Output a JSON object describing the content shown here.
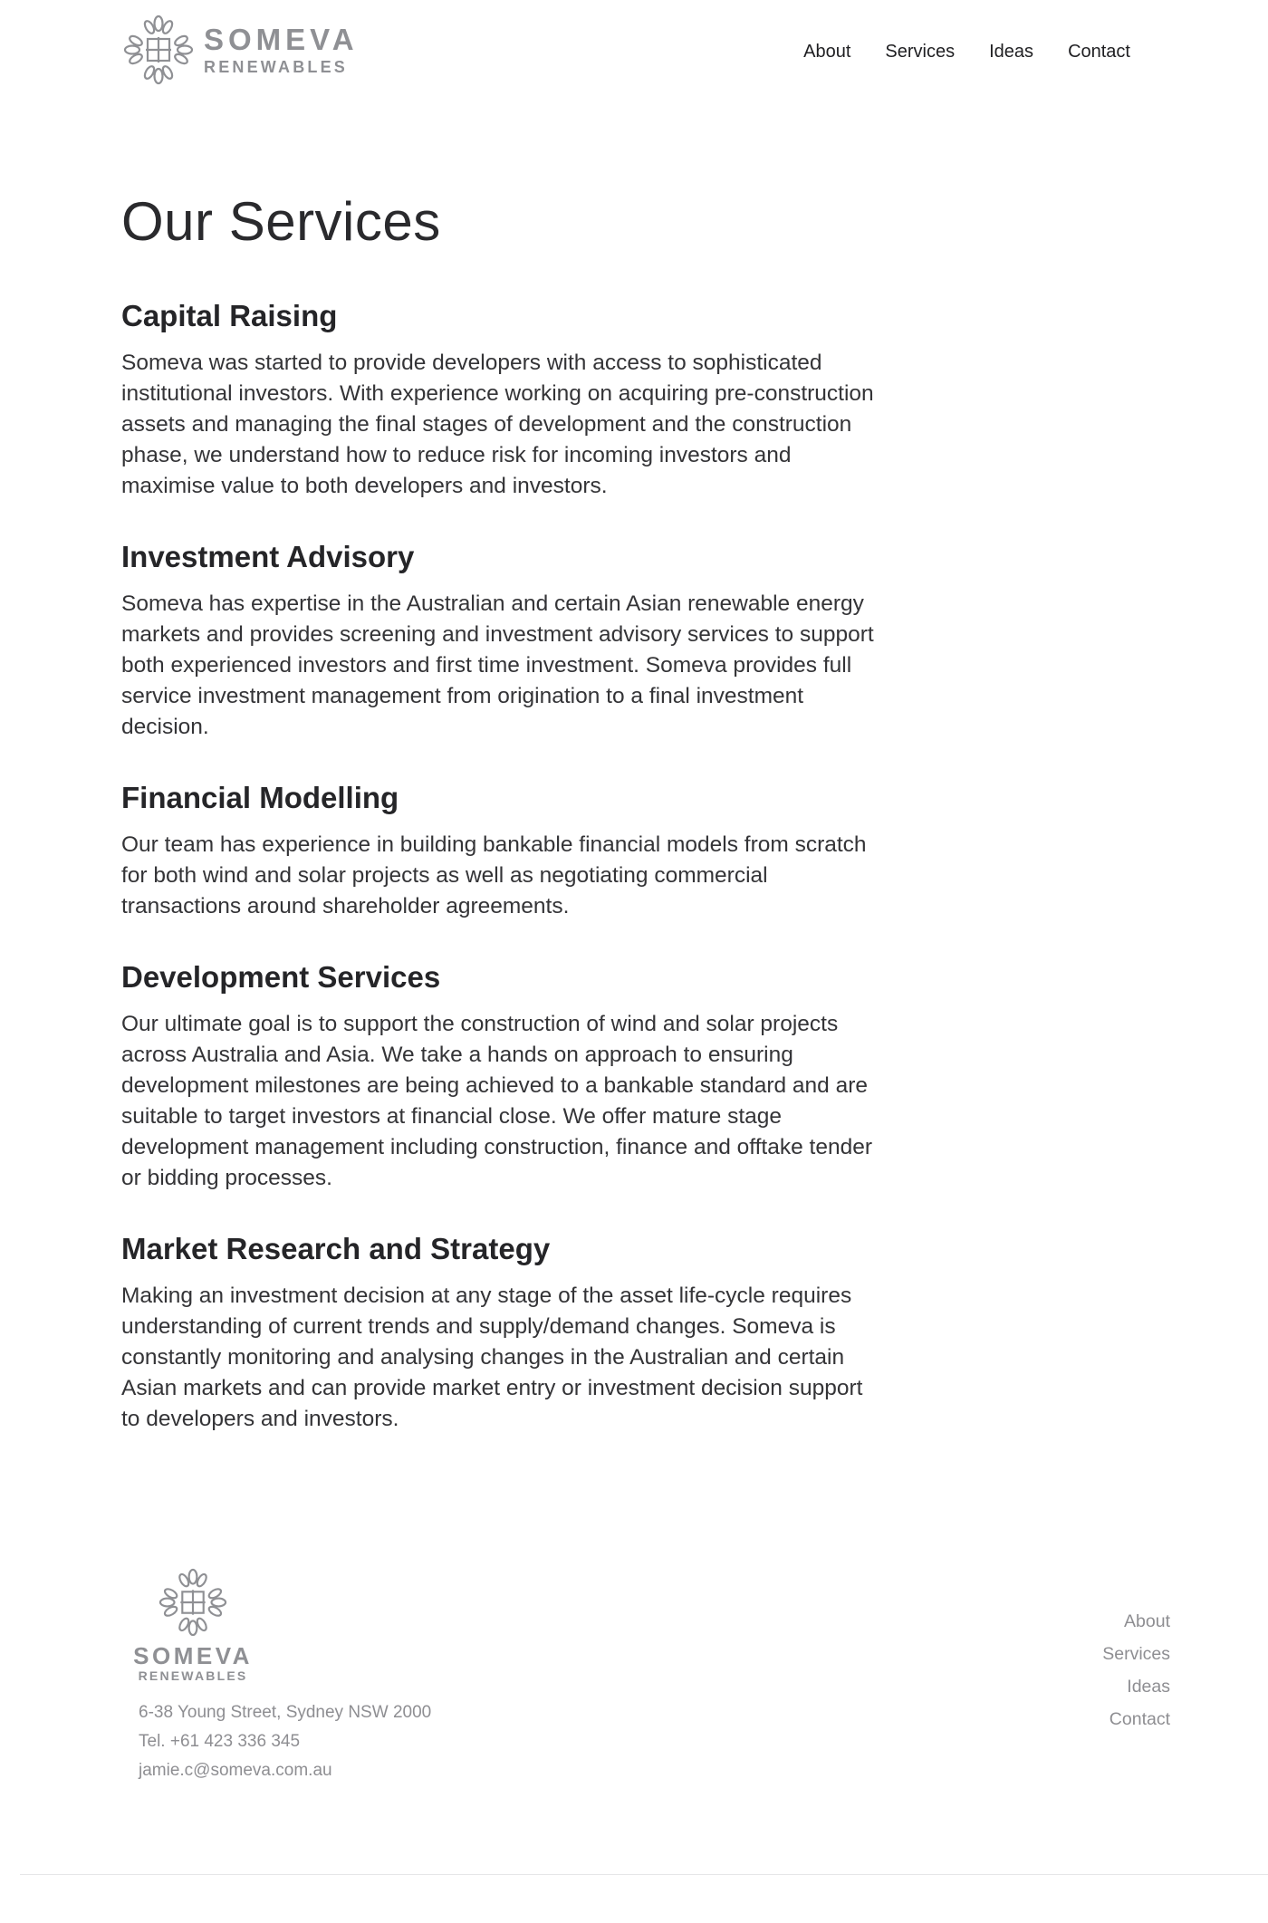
{
  "header": {
    "logo": {
      "name": "SOMEVA",
      "tagline": "RENEWABLES"
    },
    "nav": [
      "About",
      "Services",
      "Ideas",
      "Contact"
    ]
  },
  "main": {
    "title": "Our Services",
    "services": [
      {
        "heading": "Capital Raising",
        "body": "Someva was started to provide developers with access to sophisticated institutional investors. With experience working on acquiring pre-construction assets and managing the final stages of development and the construction phase, we understand how to reduce risk for incoming investors and maximise value to both developers and investors."
      },
      {
        "heading": "Investment Advisory",
        "body": "Someva has expertise in the Australian and certain Asian renewable energy markets and provides screening and investment advisory services to support both experienced investors and first time investment. Someva provides full service investment management from origination to a final investment decision."
      },
      {
        "heading": "Financial Modelling",
        "body": "Our team has experience in building bankable financial models from scratch for both wind and solar projects as well as negotiating commercial transactions around shareholder agreements."
      },
      {
        "heading": "Development Services",
        "body": "Our ultimate goal is to support the construction of wind and solar projects across Australia and Asia. We take a hands on approach to ensuring development milestones are being achieved to a bankable standard and are suitable to target investors at financial close. We offer mature stage development management including construction, finance and offtake tender or bidding processes."
      },
      {
        "heading": "Market Research and Strategy",
        "body": "Making an investment decision at any stage of the asset life-cycle requires understanding of current trends and supply/demand changes. Someva is constantly monitoring and analysing changes in the Australian and certain Asian markets and can provide market entry or investment decision support to developers and investors."
      }
    ]
  },
  "footer": {
    "logo": {
      "name": "SOMEVA",
      "tagline": "RENEWABLES"
    },
    "address": "6-38 Young Street, Sydney NSW 2000",
    "phone": "Tel. +61 423 336 345",
    "email": "jamie.c@someva.com.au",
    "nav": [
      "About",
      "Services",
      "Ideas",
      "Contact"
    ]
  },
  "colors": {
    "logo_gray": "#8f9094",
    "text_dark": "#2b2b2e",
    "footer_text": "#8e8e92"
  },
  "icons": [
    "leaf-cross-logo-icon"
  ]
}
